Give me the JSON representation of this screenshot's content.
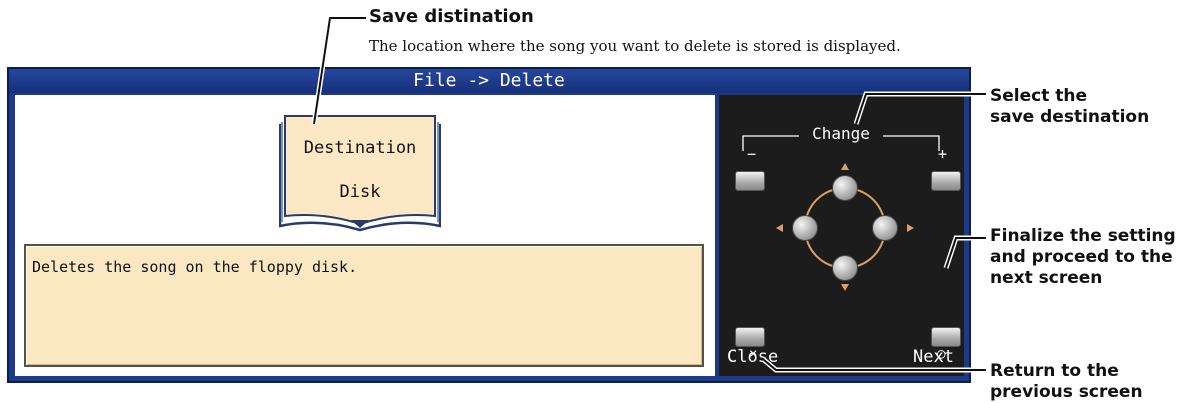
{
  "annotations": {
    "save_destination_title": "Save distination",
    "save_destination_desc": "The location where the song you want to delete is stored is displayed.",
    "select_destination": [
      "Select the",
      "save destination"
    ],
    "finalize": [
      "Finalize the setting",
      "and proceed to the",
      "next screen"
    ],
    "return": [
      "Return to the",
      "previous screen"
    ]
  },
  "screen": {
    "title": "File -> Delete",
    "book": {
      "line1": "Destination",
      "line2": "Disk"
    },
    "description": "Deletes the song on the floppy disk.",
    "controls": {
      "change_label": "Change",
      "minus": "−",
      "plus": "+",
      "close_mark": "×",
      "next_mark": "○",
      "close_label": "Close",
      "next_label": "Next"
    }
  },
  "colors": {
    "title_bar": "#1d3a8a",
    "control_panel": "#1c1c1c",
    "book_fill": "#fde8c6",
    "description_fill": "#fbe7c2",
    "ring_color": "#e0a060"
  },
  "icons": [
    "page-corner-icon",
    "arrow-up-icon",
    "arrow-down-icon",
    "arrow-left-icon",
    "arrow-right-icon"
  ]
}
